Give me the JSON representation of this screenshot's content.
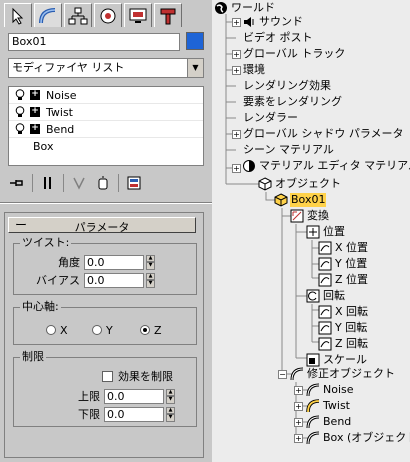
{
  "command_panel": {
    "tabs": [
      {
        "icon": "create-cursor-icon"
      },
      {
        "icon": "modify-arc-icon"
      },
      {
        "icon": "hierarchy-icon"
      },
      {
        "icon": "motion-icon"
      },
      {
        "icon": "display-monitor-icon"
      },
      {
        "icon": "utilities-hammer-icon"
      }
    ],
    "object_name": "Box01",
    "object_color": "#1e64d6",
    "modifier_list_label": "モディファイヤ リスト",
    "stack": {
      "modifiers": [
        "Noise",
        "Twist",
        "Bend"
      ],
      "base": "Box"
    },
    "rollout": {
      "collapse_symbol": "ー",
      "title": "パラメータ",
      "twist_group": {
        "label": "ツイスト:",
        "angle_label": "角度",
        "angle_value": "0.0",
        "bias_label": "バイアス",
        "bias_value": "0.0"
      },
      "axis_group": {
        "label": "中心軸:",
        "x": "X",
        "y": "Y",
        "z": "Z",
        "selected": "Z"
      },
      "limit_group": {
        "label": "制限",
        "limit_effect": "効果を制限",
        "upper_label": "上限",
        "upper_value": "0.0",
        "lower_label": "下限",
        "lower_value": "0.0"
      }
    }
  },
  "tree": {
    "nodes": [
      {
        "label": "ワールド"
      },
      {
        "label": "サウンド"
      },
      {
        "label": "ビデオ ポスト"
      },
      {
        "label": "グローバル トラック"
      },
      {
        "label": "環境"
      },
      {
        "label": "レンダリング効果"
      },
      {
        "label": "要素をレンダリング"
      },
      {
        "label": "レンダラー"
      },
      {
        "label": "グローバル シャドウ パラメータ"
      },
      {
        "label": "シーン マテリアル"
      },
      {
        "label": "マテリアル エディタ マテリアル"
      },
      {
        "label": "オブジェクト"
      },
      {
        "label": "Box01"
      },
      {
        "label": "変換"
      },
      {
        "label": "位置"
      },
      {
        "label": "X 位置"
      },
      {
        "label": "Y 位置"
      },
      {
        "label": "Z 位置"
      },
      {
        "label": "回転"
      },
      {
        "label": "X 回転"
      },
      {
        "label": "Y 回転"
      },
      {
        "label": "Z 回転"
      },
      {
        "label": "スケール"
      },
      {
        "label": "修正オブジェクト"
      },
      {
        "label": "Noise"
      },
      {
        "label": "Twist"
      },
      {
        "label": "Bend"
      },
      {
        "label": "Box (オブジェクト)"
      }
    ]
  }
}
